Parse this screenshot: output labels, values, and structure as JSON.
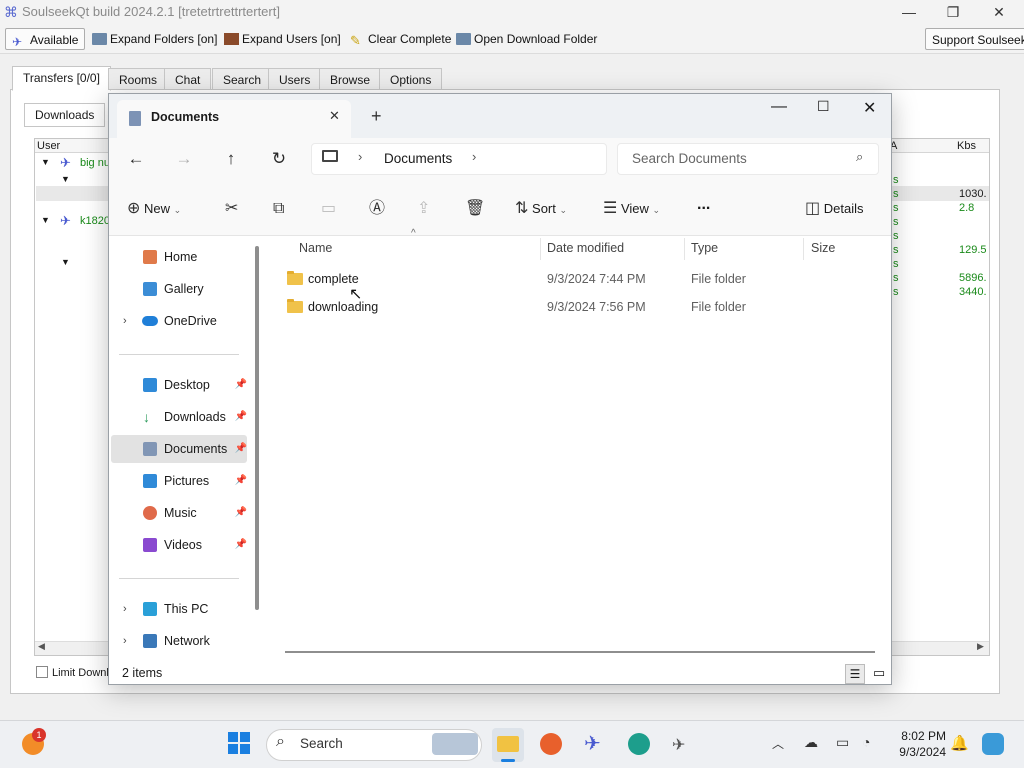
{
  "soulseek": {
    "title": "SoulseekQt build 2024.2.1 [tretetrtrettrtertert]",
    "toolbar": {
      "available": "Available",
      "expand_folders": "Expand Folders [on]",
      "expand_users": "Expand Users [on]",
      "clear_complete": "Clear Complete",
      "open_download_folder": "Open Download Folder",
      "support": "Support Soulseek!"
    },
    "tabs": [
      "Transfers [0/0]",
      "Rooms",
      "Chat",
      "Search",
      "Users",
      "Browse",
      "Options"
    ],
    "subtab": "Downloads",
    "columns": {
      "user": "User",
      "a": "A",
      "kbs": "Kbs"
    },
    "users": [
      "big nu",
      "k1820"
    ],
    "right_col_s": [
      "s",
      "s",
      "s",
      "s",
      "s",
      "s",
      "s",
      "s",
      "s"
    ],
    "kbs_values": [
      "1030.",
      "2.8",
      "129.5",
      "5896.",
      "3440."
    ],
    "limit_label": "Limit Downl"
  },
  "explorer": {
    "tab_title": "Documents",
    "new_tab": "+",
    "breadcrumb": "Documents",
    "search_placeholder": "Search Documents",
    "commands": {
      "new": "New",
      "sort": "Sort",
      "view": "View",
      "more": "...",
      "details": "Details"
    },
    "sidebar": {
      "home": "Home",
      "gallery": "Gallery",
      "onedrive": "OneDrive",
      "desktop": "Desktop",
      "downloads": "Downloads",
      "documents": "Documents",
      "pictures": "Pictures",
      "music": "Music",
      "videos": "Videos",
      "this_pc": "This PC",
      "network": "Network"
    },
    "columns": {
      "name": "Name",
      "date": "Date modified",
      "type": "Type",
      "size": "Size"
    },
    "files": [
      {
        "name": "complete",
        "date": "9/3/2024 7:44 PM",
        "type": "File folder"
      },
      {
        "name": "downloading",
        "date": "9/3/2024 7:56 PM",
        "type": "File folder"
      }
    ],
    "status": "2 items"
  },
  "taskbar": {
    "search": "Search",
    "time": "8:02 PM",
    "date": "9/3/2024",
    "badge": "1"
  }
}
